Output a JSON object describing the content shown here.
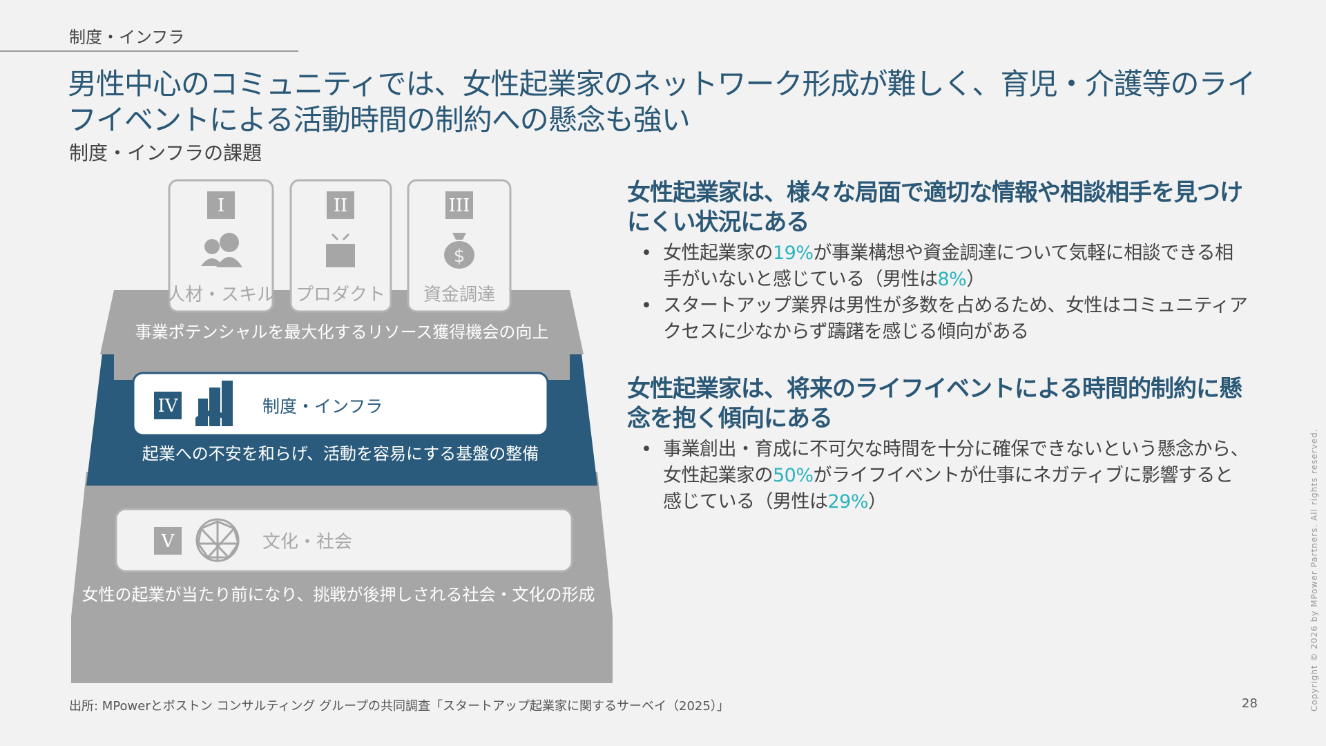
{
  "header": {
    "section_label": "制度・インフラ",
    "title": "男性中心のコミュニティでは、女性起業家のネットワーク形成が難しく、育児・介護等のライフイベントによる活動時間の制約への懸念も強い",
    "subtitle": "制度・インフラの課題"
  },
  "diagram": {
    "top_cards": [
      {
        "numeral": "I",
        "label": "人材・スキル",
        "icon": "people-icon"
      },
      {
        "numeral": "II",
        "label": "プロダクト",
        "icon": "product-box-icon"
      },
      {
        "numeral": "III",
        "label": "資金調達",
        "icon": "money-bag-icon"
      }
    ],
    "tier_top_text": "事業ポテンシャルを最大化するリソース獲得機会の向上",
    "tier_middle": {
      "numeral": "IV",
      "label": "制度・インフラ",
      "icon": "city-infrastructure-icon",
      "text": "起業への不安を和らげ、活動を容易にする基盤の整備"
    },
    "tier_bottom": {
      "numeral": "V",
      "label": "文化・社会",
      "icon": "network-globe-icon",
      "text": "女性の起業が当たり前になり、挑戦が後押しされる社会・文化の形成"
    },
    "colors": {
      "accent": "#2a5b7c",
      "gray_band": "#a6a6a6",
      "card_border": "#b4b4b4",
      "highlight": "#2ab3bf"
    }
  },
  "findings": [
    {
      "heading": "女性起業家は、様々な局面で適切な情報や相談相手を見つけにくい状況にある",
      "bullets": [
        {
          "pre": "女性起業家の",
          "h1": "19%",
          "mid": "が事業構想や資金調達について気軽に相談できる相手がいないと感じている（男性は",
          "h2": "8%",
          "post": "）"
        },
        {
          "pre": "スタートアップ業界は男性が多数を占めるため、女性はコミュニティアクセスに少なからず躊躇を感じる傾向がある",
          "h1": "",
          "mid": "",
          "h2": "",
          "post": ""
        }
      ]
    },
    {
      "heading": "女性起業家は、将来のライフイベントによる時間的制約に懸念を抱く傾向にある",
      "bullets": [
        {
          "pre": "事業創出・育成に不可欠な時間を十分に確保できないという懸念から、女性起業家の",
          "h1": "50%",
          "mid": "がライフイベントが仕事にネガティブに影響すると感じている（男性は",
          "h2": "29%",
          "post": "）"
        }
      ]
    }
  ],
  "footer": {
    "source": "出所: MPowerとボストン コンサルティング グループの共同調査「スタートアップ起業家に関するサーベイ（2025）」",
    "page_number": "28",
    "copyright": "Copyright © 2026 by MPower Partners. All rights reserved."
  }
}
